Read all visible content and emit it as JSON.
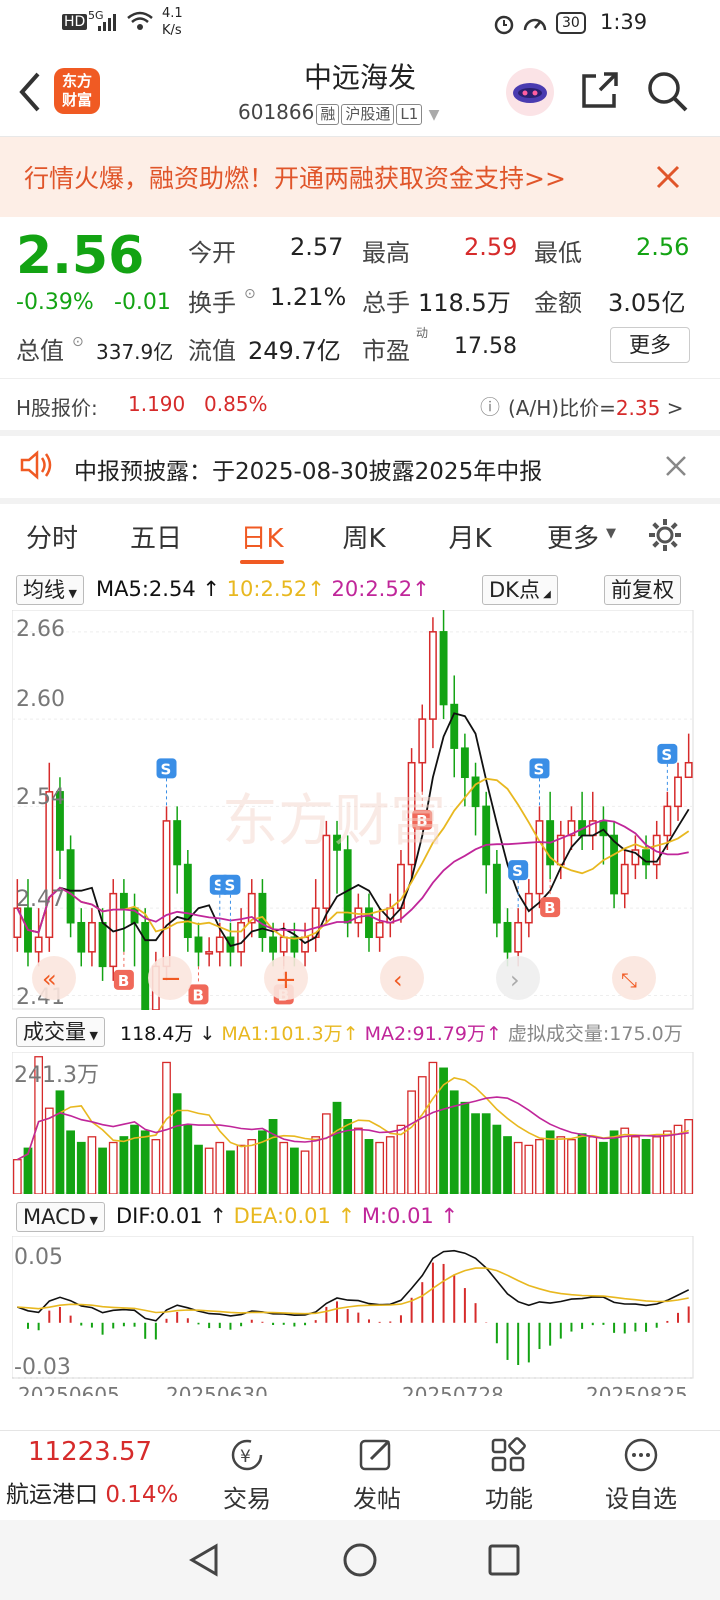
{
  "status": {
    "hd": "HD",
    "net": "5G",
    "speed_val": "4.1",
    "speed_unit": "K/s",
    "battery": "30",
    "time": "1:39"
  },
  "header": {
    "logo_line1": "东方",
    "logo_line2": "财富",
    "title": "中远海发",
    "code": "601866",
    "tags": [
      "融",
      "沪股通",
      "L1"
    ]
  },
  "banner": {
    "text": "行情火爆，融资助燃！开通两融获取资金支持>>"
  },
  "quote": {
    "price": "2.56",
    "change_pct": "-0.39%",
    "change": "-0.01",
    "open_label": "今开",
    "open": "2.57",
    "high_label": "最高",
    "high": "2.59",
    "low_label": "最低",
    "low": "2.56",
    "turnover_label": "换手",
    "turnover": "1.21%",
    "volume_label": "总手",
    "volume": "118.5万",
    "amount_label": "金额",
    "amount": "3.05亿",
    "mktcap_label": "总值",
    "mktcap": "337.9亿",
    "float_label": "流值",
    "float": "249.7亿",
    "pe_label": "市盈",
    "pe_sup": "动",
    "pe": "17.58",
    "more": "更多"
  },
  "hshare": {
    "label": "H股报价:",
    "price": "1.190",
    "pct": "0.85%",
    "ratio_label": "(A/H)比价=",
    "ratio": "2.35",
    "arrow": ">"
  },
  "notice": {
    "text": "中报预披露：于2025-08-30披露2025年中报"
  },
  "tabs": [
    "分时",
    "五日",
    "日K",
    "周K",
    "月K",
    "更多"
  ],
  "active_tab": "日K",
  "chart_toolbar": {
    "ma_select": "均线",
    "ma5": "MA5:2.54",
    "ma10": "10:2.52",
    "ma20": "20:2.52",
    "dk": "DK点",
    "adjust": "前复权"
  },
  "vol_toolbar": {
    "select": "成交量",
    "vol": "118.4万",
    "ma1": "MA1:101.3万",
    "ma2": "MA2:91.79万",
    "virtual": "虚拟成交量:175.0万"
  },
  "macd_toolbar": {
    "select": "MACD",
    "dif": "DIF:0.01",
    "dea": "DEA:0.01",
    "m": "M:0.01"
  },
  "bottom": {
    "index_value": "11223.57",
    "index_name": "航运港口",
    "index_pct": "0.14%",
    "items": [
      "交易",
      "发帖",
      "功能",
      "设自选"
    ]
  },
  "colors": {
    "up": "#d62b2b",
    "down": "#13a313",
    "accent": "#f05a23",
    "ma5": "#111111",
    "ma10": "#e8b820",
    "ma20": "#c0269a"
  },
  "chart_data": [
    {
      "type": "candlestick",
      "title": "日K",
      "y_ticks": [
        "2.66",
        "2.60",
        "2.54",
        "2.47",
        "2.41"
      ],
      "ylim": [
        2.4,
        2.675
      ],
      "x_ticks": [
        "20250605",
        "20250630",
        "20250728",
        "20250825"
      ],
      "series": [
        {
          "name": "MA5",
          "last": 2.54
        },
        {
          "name": "MA10",
          "last": 2.52
        },
        {
          "name": "MA20",
          "last": 2.52
        }
      ],
      "markers": [
        "S",
        "B",
        "S",
        "B",
        "S",
        "B",
        "B",
        "S",
        "S",
        "B",
        "S"
      ],
      "candles": [
        [
          2.45,
          2.47,
          2.49,
          2.44
        ],
        [
          2.47,
          2.44,
          2.49,
          2.43
        ],
        [
          2.44,
          2.45,
          2.47,
          2.43
        ],
        [
          2.45,
          2.55,
          2.57,
          2.44
        ],
        [
          2.55,
          2.51,
          2.56,
          2.49
        ],
        [
          2.51,
          2.46,
          2.52,
          2.45
        ],
        [
          2.46,
          2.44,
          2.47,
          2.43
        ],
        [
          2.44,
          2.46,
          2.47,
          2.43
        ],
        [
          2.46,
          2.43,
          2.47,
          2.42
        ],
        [
          2.43,
          2.48,
          2.49,
          2.42
        ],
        [
          2.48,
          2.47,
          2.49,
          2.44
        ],
        [
          2.47,
          2.46,
          2.48,
          2.43
        ],
        [
          2.46,
          2.4,
          2.47,
          2.39
        ],
        [
          2.4,
          2.43,
          2.44,
          2.39
        ],
        [
          2.43,
          2.53,
          2.54,
          2.42
        ],
        [
          2.53,
          2.5,
          2.54,
          2.48
        ],
        [
          2.5,
          2.45,
          2.51,
          2.44
        ],
        [
          2.45,
          2.44,
          2.46,
          2.43
        ],
        [
          2.44,
          2.44,
          2.45,
          2.43
        ],
        [
          2.44,
          2.45,
          2.46,
          2.43
        ],
        [
          2.45,
          2.44,
          2.46,
          2.43
        ],
        [
          2.44,
          2.46,
          2.47,
          2.43
        ],
        [
          2.46,
          2.48,
          2.49,
          2.45
        ],
        [
          2.48,
          2.45,
          2.49,
          2.44
        ],
        [
          2.45,
          2.44,
          2.46,
          2.43
        ],
        [
          2.44,
          2.45,
          2.46,
          2.43
        ],
        [
          2.45,
          2.44,
          2.46,
          2.43
        ],
        [
          2.44,
          2.45,
          2.46,
          2.43
        ],
        [
          2.45,
          2.47,
          2.49,
          2.44
        ],
        [
          2.47,
          2.52,
          2.53,
          2.46
        ],
        [
          2.52,
          2.51,
          2.53,
          2.48
        ],
        [
          2.51,
          2.46,
          2.52,
          2.45
        ],
        [
          2.46,
          2.47,
          2.48,
          2.45
        ],
        [
          2.47,
          2.45,
          2.48,
          2.44
        ],
        [
          2.45,
          2.46,
          2.47,
          2.44
        ],
        [
          2.46,
          2.47,
          2.48,
          2.45
        ],
        [
          2.47,
          2.5,
          2.51,
          2.46
        ],
        [
          2.5,
          2.57,
          2.58,
          2.49
        ],
        [
          2.57,
          2.6,
          2.61,
          2.55
        ],
        [
          2.6,
          2.66,
          2.67,
          2.58
        ],
        [
          2.66,
          2.61,
          2.68,
          2.6
        ],
        [
          2.61,
          2.58,
          2.63,
          2.56
        ],
        [
          2.58,
          2.56,
          2.59,
          2.54
        ],
        [
          2.56,
          2.54,
          2.57,
          2.52
        ],
        [
          2.54,
          2.5,
          2.55,
          2.48
        ],
        [
          2.5,
          2.46,
          2.51,
          2.45
        ],
        [
          2.46,
          2.44,
          2.47,
          2.43
        ],
        [
          2.44,
          2.46,
          2.47,
          2.43
        ],
        [
          2.46,
          2.48,
          2.49,
          2.45
        ],
        [
          2.48,
          2.53,
          2.54,
          2.47
        ],
        [
          2.53,
          2.5,
          2.55,
          2.49
        ],
        [
          2.5,
          2.52,
          2.53,
          2.49
        ],
        [
          2.52,
          2.53,
          2.54,
          2.51
        ],
        [
          2.53,
          2.52,
          2.55,
          2.51
        ],
        [
          2.52,
          2.53,
          2.55,
          2.51
        ],
        [
          2.53,
          2.52,
          2.54,
          2.5
        ],
        [
          2.52,
          2.48,
          2.53,
          2.47
        ],
        [
          2.48,
          2.5,
          2.51,
          2.47
        ],
        [
          2.5,
          2.51,
          2.52,
          2.49
        ],
        [
          2.51,
          2.5,
          2.52,
          2.49
        ],
        [
          2.5,
          2.52,
          2.53,
          2.49
        ],
        [
          2.52,
          2.54,
          2.55,
          2.51
        ],
        [
          2.54,
          2.56,
          2.57,
          2.53
        ],
        [
          2.56,
          2.57,
          2.59,
          2.56
        ]
      ]
    },
    {
      "type": "bar",
      "title": "成交量",
      "y_ticks": [
        "241.3万"
      ],
      "values": [
        60,
        80,
        240,
        150,
        180,
        110,
        90,
        100,
        80,
        90,
        100,
        120,
        110,
        95,
        230,
        175,
        120,
        85,
        80,
        90,
        75,
        85,
        95,
        110,
        130,
        90,
        80,
        75,
        100,
        140,
        160,
        130,
        115,
        95,
        90,
        100,
        120,
        180,
        205,
        230,
        220,
        180,
        160,
        140,
        140,
        120,
        100,
        90,
        85,
        95,
        110,
        100,
        95,
        105,
        100,
        90,
        110,
        115,
        100,
        95,
        100,
        110,
        120,
        130
      ]
    },
    {
      "type": "bar",
      "title": "MACD",
      "y_ticks": [
        "0.05",
        "-0.03"
      ],
      "series": [
        {
          "name": "DIF",
          "last": 0.01
        },
        {
          "name": "DEA",
          "last": 0.01
        },
        {
          "name": "M",
          "last": 0.01
        }
      ]
    }
  ]
}
